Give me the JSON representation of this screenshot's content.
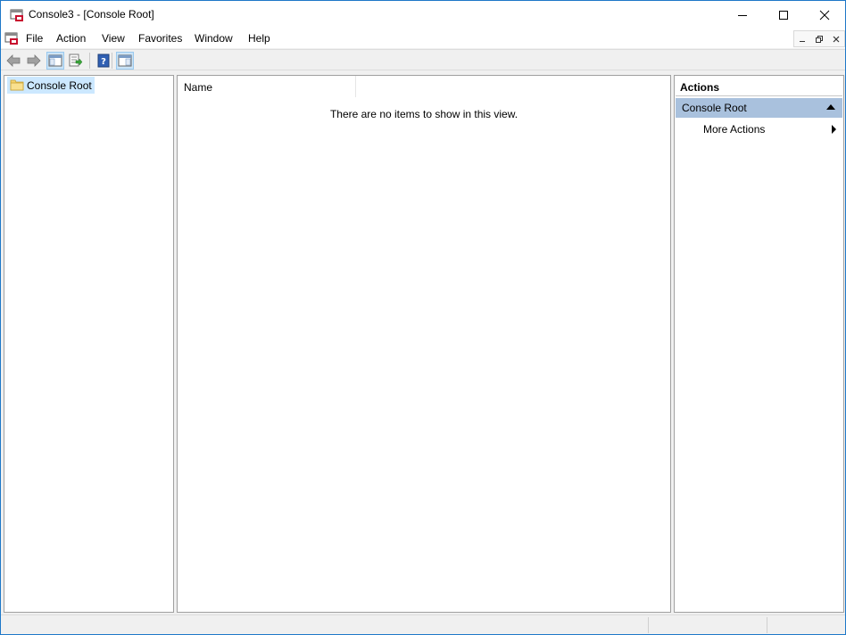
{
  "window": {
    "title": "Console3 - [Console Root]"
  },
  "menubar": {
    "items": [
      {
        "label": "File"
      },
      {
        "label": "Action"
      },
      {
        "label": "View"
      },
      {
        "label": "Favorites"
      },
      {
        "label": "Window"
      },
      {
        "label": "Help"
      }
    ]
  },
  "toolbar": {
    "buttons": [
      {
        "icon": "back-arrow-icon"
      },
      {
        "icon": "forward-arrow-icon"
      },
      {
        "icon": "show-hide-console-tree-icon"
      },
      {
        "icon": "export-list-icon"
      },
      {
        "icon": "help-icon"
      },
      {
        "icon": "show-hide-action-pane-icon"
      }
    ]
  },
  "tree": {
    "root_label": "Console Root"
  },
  "list": {
    "columns": [
      {
        "label": "Name"
      }
    ],
    "empty_message": "There are no items to show in this view."
  },
  "actions": {
    "header": "Actions",
    "group_label": "Console Root",
    "items": [
      {
        "label": "More Actions"
      }
    ]
  },
  "colors": {
    "accent_border": "#1e78c8",
    "selection": "#cce8ff",
    "actions_group_bg": "#a9c1dd"
  }
}
